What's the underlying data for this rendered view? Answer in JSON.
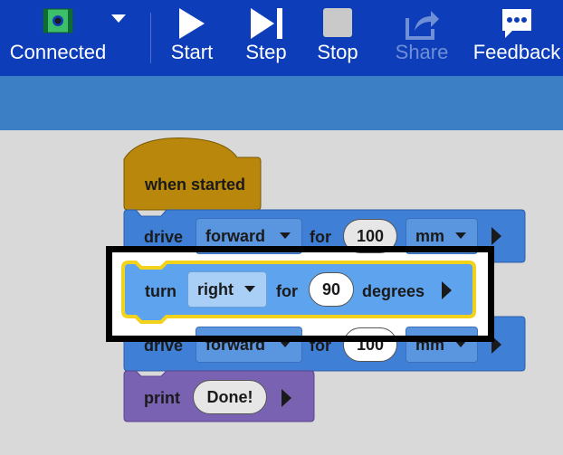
{
  "toolbar": {
    "connection": {
      "label": "Connected",
      "icon": "robot-brain-icon",
      "dropdown_icon": "chevron-down-icon"
    },
    "start": {
      "label": "Start",
      "icon": "play-icon"
    },
    "step": {
      "label": "Step",
      "icon": "step-icon"
    },
    "stop": {
      "label": "Stop",
      "icon": "stop-icon"
    },
    "share": {
      "label": "Share",
      "icon": "share-icon",
      "disabled": true
    },
    "feedback": {
      "label": "Feedback",
      "icon": "speech-bubble-icon"
    }
  },
  "blocks": {
    "when_started": {
      "label": "when started",
      "color": "#b8870b"
    },
    "drive1": {
      "keyword": "drive",
      "direction": "forward",
      "for_label": "for",
      "amount": "100",
      "unit": "mm",
      "color": "#3f7fd6"
    },
    "turn": {
      "keyword": "turn",
      "direction": "right",
      "for_label": "for",
      "amount": "90",
      "unit": "degrees",
      "color": "#5ea3ee",
      "highlighted": true
    },
    "drive2": {
      "keyword": "drive",
      "direction": "forward",
      "for_label": "for",
      "amount": "100",
      "unit": "mm",
      "color": "#3f7fd6"
    },
    "print": {
      "keyword": "print",
      "value": "Done!",
      "color": "#7a62b3"
    }
  },
  "colors": {
    "toolbar": "#0d3db8",
    "subbar": "#3d7fc4",
    "workspace": "#d9d9d9",
    "highlight_outline": "#f2d21b",
    "focus_box": "#000000"
  }
}
